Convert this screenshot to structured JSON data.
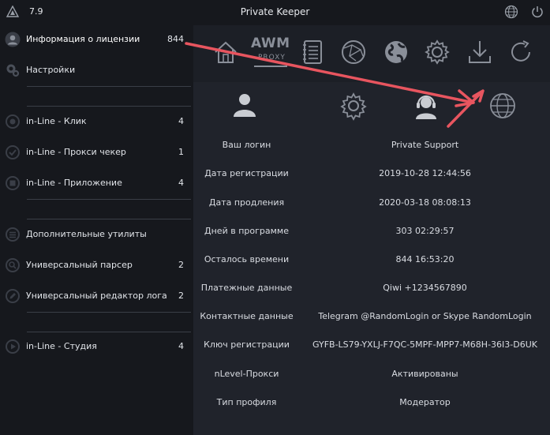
{
  "window": {
    "version": "7.9",
    "title": "Private Keeper"
  },
  "sidebar": {
    "items": [
      {
        "label": "Информация о лицензии",
        "count": "844",
        "icon": "user-icon"
      },
      {
        "label": "Настройки",
        "count": "",
        "icon": "gear-icon"
      },
      {
        "label": "in-Line - Клик",
        "count": "4",
        "icon": "click-icon"
      },
      {
        "label": "in-Line - Прокси чекер",
        "count": "1",
        "icon": "proxy-icon"
      },
      {
        "label": "in-Line - Приложение",
        "count": "4",
        "icon": "app-icon"
      },
      {
        "label": "Дополнительные утилиты",
        "count": "",
        "icon": "list-icon"
      },
      {
        "label": "Универсальный парсер",
        "count": "2",
        "icon": "search-icon"
      },
      {
        "label": "Универсальный редактор лога",
        "count": "2",
        "icon": "edit-icon"
      },
      {
        "label": "in-Line - Студия",
        "count": "4",
        "icon": "studio-icon"
      }
    ]
  },
  "toolbar": {
    "awm_label": "AWM",
    "awm_sub": "PROXY"
  },
  "license": {
    "rows": [
      {
        "key": "Ваш логин",
        "value": "Private Support"
      },
      {
        "key": "Дата регистрации",
        "value": "2019-10-28 12:44:56"
      },
      {
        "key": "Дата продления",
        "value": "2020-03-18 08:08:13"
      },
      {
        "key": "Дней в программе",
        "value": "303 02:29:57"
      },
      {
        "key": "Осталось времени",
        "value": "844 16:53:20"
      },
      {
        "key": "Платежные данные",
        "value": "Qiwi +1234567890"
      },
      {
        "key": "Контактные данные",
        "value": "Telegram @RandomLogin or Skype RandomLogin"
      },
      {
        "key": "Ключ регистрации",
        "value": "GYFB-LS79-YXLJ-F7QC-5MPF-MPP7-M68H-36I3-D6UK"
      },
      {
        "key": "nLevel-Прокси",
        "value": "Активированы"
      },
      {
        "key": "Тип профиля",
        "value": "Модератор"
      }
    ]
  },
  "colors": {
    "annotation_arrow": "#e8555f",
    "icon": "#8a8f99",
    "active_icon": "#c9ccd2"
  }
}
